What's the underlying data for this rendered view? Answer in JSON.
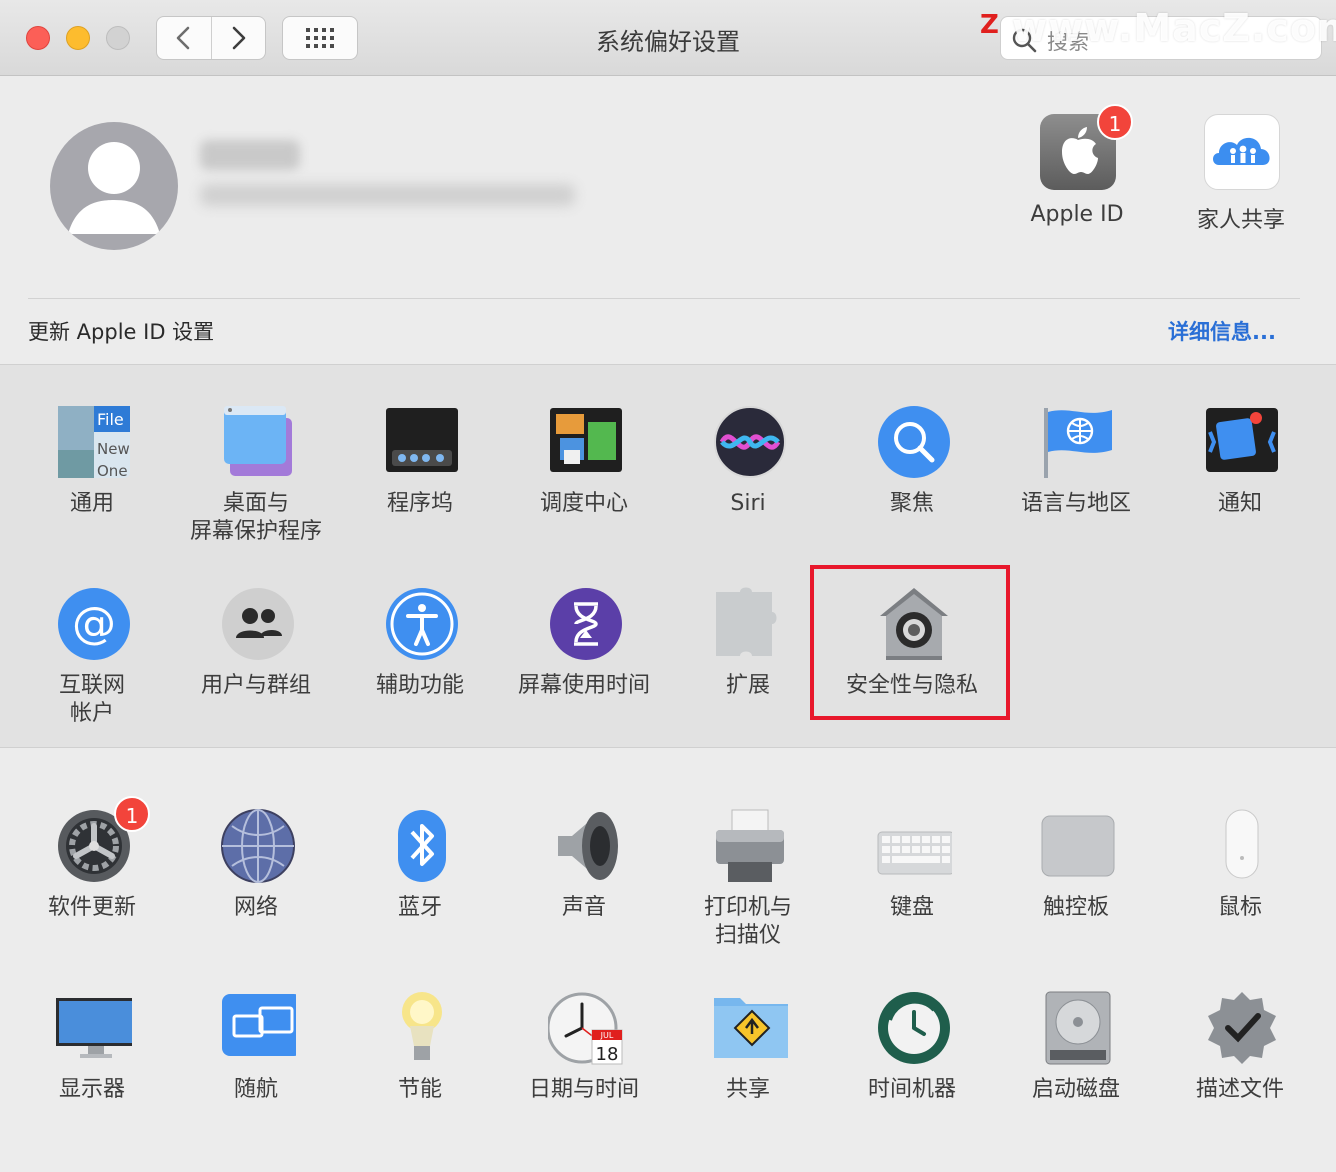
{
  "window": {
    "title": "系统偏好设置",
    "search_placeholder": "搜索",
    "watermark": "www.MacZ.com",
    "watermark_logo": "Z"
  },
  "account": {
    "name_blurred": "",
    "update_text": "更新 Apple ID 设置",
    "details_link": "详细信息...",
    "apple_id": {
      "label": "Apple ID",
      "badge": "1"
    },
    "family": {
      "label": "家人共享"
    }
  },
  "row1": [
    {
      "label": "通用",
      "icon": "general-icon"
    },
    {
      "label": "桌面与\n屏幕保护程序",
      "icon": "desktop-screensaver-icon"
    },
    {
      "label": "程序坞",
      "icon": "dock-icon"
    },
    {
      "label": "调度中心",
      "icon": "mission-control-icon"
    },
    {
      "label": "Siri",
      "icon": "siri-icon"
    },
    {
      "label": "聚焦",
      "icon": "spotlight-icon"
    },
    {
      "label": "语言与地区",
      "icon": "language-region-icon"
    },
    {
      "label": "通知",
      "icon": "notifications-icon"
    }
  ],
  "row2": [
    {
      "label": "互联网\n帐户",
      "icon": "internet-accounts-icon"
    },
    {
      "label": "用户与群组",
      "icon": "users-groups-icon"
    },
    {
      "label": "辅助功能",
      "icon": "accessibility-icon"
    },
    {
      "label": "屏幕使用时间",
      "icon": "screen-time-icon"
    },
    {
      "label": "扩展",
      "icon": "extensions-icon"
    },
    {
      "label": "安全性与隐私",
      "icon": "security-privacy-icon"
    }
  ],
  "row3": [
    {
      "label": "软件更新",
      "icon": "software-update-icon",
      "badge": "1"
    },
    {
      "label": "网络",
      "icon": "network-icon"
    },
    {
      "label": "蓝牙",
      "icon": "bluetooth-icon"
    },
    {
      "label": "声音",
      "icon": "sound-icon"
    },
    {
      "label": "打印机与\n扫描仪",
      "icon": "printers-scanners-icon"
    },
    {
      "label": "键盘",
      "icon": "keyboard-icon"
    },
    {
      "label": "触控板",
      "icon": "trackpad-icon"
    },
    {
      "label": "鼠标",
      "icon": "mouse-icon"
    }
  ],
  "row4": [
    {
      "label": "显示器",
      "icon": "displays-icon"
    },
    {
      "label": "随航",
      "icon": "sidecar-icon"
    },
    {
      "label": "节能",
      "icon": "energy-saver-icon"
    },
    {
      "label": "日期与时间",
      "icon": "date-time-icon",
      "calendar_month": "JUL",
      "calendar_day": "18"
    },
    {
      "label": "共享",
      "icon": "sharing-icon"
    },
    {
      "label": "时间机器",
      "icon": "time-machine-icon"
    },
    {
      "label": "启动磁盘",
      "icon": "startup-disk-icon"
    },
    {
      "label": "描述文件",
      "icon": "profiles-icon"
    }
  ],
  "colors": {
    "highlight_border": "#e8182c",
    "link": "#2a6fd6",
    "badge": "#f2443b"
  }
}
